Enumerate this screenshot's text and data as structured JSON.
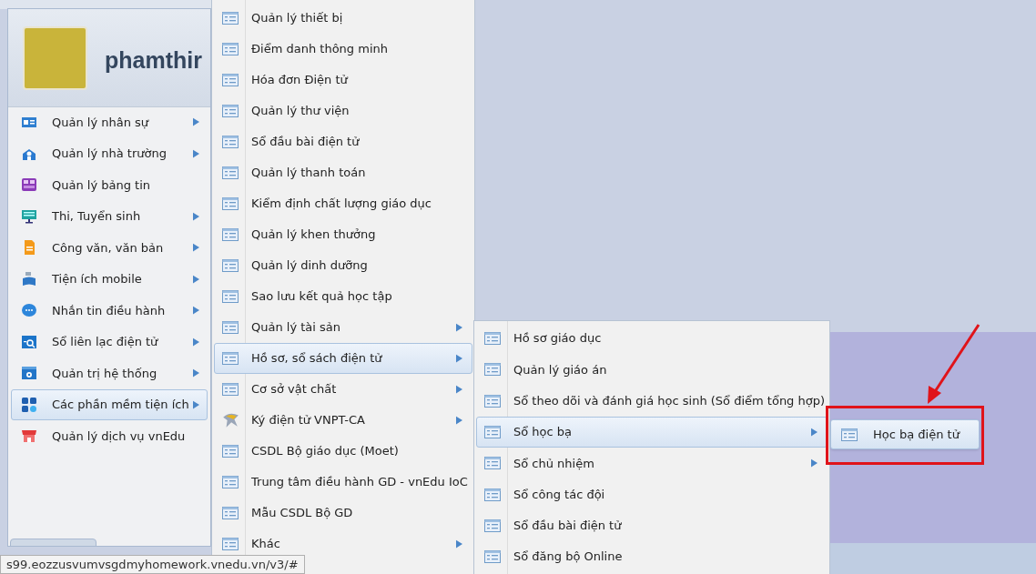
{
  "user": {
    "name": "phamthir"
  },
  "main_menu": [
    {
      "label": "Quản lý nhân sự",
      "kind": "staff",
      "has_submenu": true,
      "selected": false
    },
    {
      "label": "Quản lý nhà trường",
      "kind": "school",
      "has_submenu": true,
      "selected": false
    },
    {
      "label": "Quản lý bảng tin",
      "kind": "news",
      "has_submenu": false,
      "selected": false
    },
    {
      "label": "Thi, Tuyển sinh",
      "kind": "exam",
      "has_submenu": true,
      "selected": false
    },
    {
      "label": "Công văn, văn bản",
      "kind": "document",
      "has_submenu": true,
      "selected": false
    },
    {
      "label": "Tiện ích mobile",
      "kind": "mobile",
      "has_submenu": true,
      "selected": false
    },
    {
      "label": "Nhắn tin điều hành",
      "kind": "chat",
      "has_submenu": true,
      "selected": false
    },
    {
      "label": "Sổ liên lạc điện tử",
      "kind": "contact",
      "has_submenu": true,
      "selected": false
    },
    {
      "label": "Quản trị hệ thống",
      "kind": "settings",
      "has_submenu": true,
      "selected": false
    },
    {
      "label": "Các phần mềm tiện ích",
      "kind": "apps",
      "has_submenu": true,
      "selected": true
    },
    {
      "label": "Quản lý dịch vụ vnEdu",
      "kind": "service",
      "has_submenu": false,
      "selected": false
    }
  ],
  "submenu_1": [
    {
      "label": "Quản lý thiết bị",
      "kind": "list",
      "has_submenu": false,
      "selected": false
    },
    {
      "label": "Điểm danh thông minh",
      "kind": "list",
      "has_submenu": false,
      "selected": false
    },
    {
      "label": "Hóa đơn Điện tử",
      "kind": "list",
      "has_submenu": false,
      "selected": false
    },
    {
      "label": "Quản lý thư viện",
      "kind": "list",
      "has_submenu": false,
      "selected": false
    },
    {
      "label": "Sổ đầu bài điện tử",
      "kind": "list",
      "has_submenu": false,
      "selected": false
    },
    {
      "label": "Quản lý thanh toán",
      "kind": "list",
      "has_submenu": false,
      "selected": false
    },
    {
      "label": "Kiểm định chất lượng giáo dục",
      "kind": "list",
      "has_submenu": false,
      "selected": false
    },
    {
      "label": "Quản lý khen thưởng",
      "kind": "list",
      "has_submenu": false,
      "selected": false
    },
    {
      "label": "Quản lý dinh dưỡng",
      "kind": "list",
      "has_submenu": false,
      "selected": false
    },
    {
      "label": "Sao lưu kết quả học tập",
      "kind": "list",
      "has_submenu": false,
      "selected": false
    },
    {
      "label": "Quản lý tài sản",
      "kind": "list",
      "has_submenu": true,
      "selected": false
    },
    {
      "label": "Hồ sơ, sổ sách điện tử",
      "kind": "list",
      "has_submenu": true,
      "selected": true
    },
    {
      "label": "Cơ sở vật chất",
      "kind": "list",
      "has_submenu": true,
      "selected": false
    },
    {
      "label": "Ký điện tử VNPT-CA",
      "kind": "signature",
      "has_submenu": true,
      "selected": false
    },
    {
      "label": "CSDL Bộ giáo dục (Moet)",
      "kind": "list",
      "has_submenu": false,
      "selected": false
    },
    {
      "label": "Trung tâm điều hành GD - vnEdu IoC",
      "kind": "list",
      "has_submenu": false,
      "selected": false
    },
    {
      "label": "Mẫu CSDL Bộ GD",
      "kind": "list",
      "has_submenu": false,
      "selected": false
    },
    {
      "label": "Khác",
      "kind": "list",
      "has_submenu": true,
      "selected": false
    }
  ],
  "submenu_2": [
    {
      "label": "Hồ sơ giáo dục",
      "kind": "list",
      "has_submenu": false,
      "selected": false
    },
    {
      "label": "Quản lý giáo án",
      "kind": "list",
      "has_submenu": false,
      "selected": false
    },
    {
      "label": "Sổ theo dõi và đánh giá học sinh (Sổ điểm tổng hợp)",
      "kind": "list",
      "has_submenu": false,
      "selected": false
    },
    {
      "label": "Sổ học bạ",
      "kind": "list",
      "has_submenu": true,
      "selected": true
    },
    {
      "label": "Sổ chủ nhiệm",
      "kind": "list",
      "has_submenu": true,
      "selected": false
    },
    {
      "label": "Sổ công tác đội",
      "kind": "list",
      "has_submenu": false,
      "selected": false
    },
    {
      "label": "Sổ đầu bài điện tử",
      "kind": "list",
      "has_submenu": false,
      "selected": false
    },
    {
      "label": "Sổ đăng bộ Online",
      "kind": "list",
      "has_submenu": false,
      "selected": false
    }
  ],
  "submenu_3": [
    {
      "label": "Học bạ điện tử",
      "kind": "list",
      "has_submenu": false,
      "selected": true
    }
  ],
  "status_url": "s99.eozzusvumvsgdmyhomework.vnedu.vn/v3/#"
}
